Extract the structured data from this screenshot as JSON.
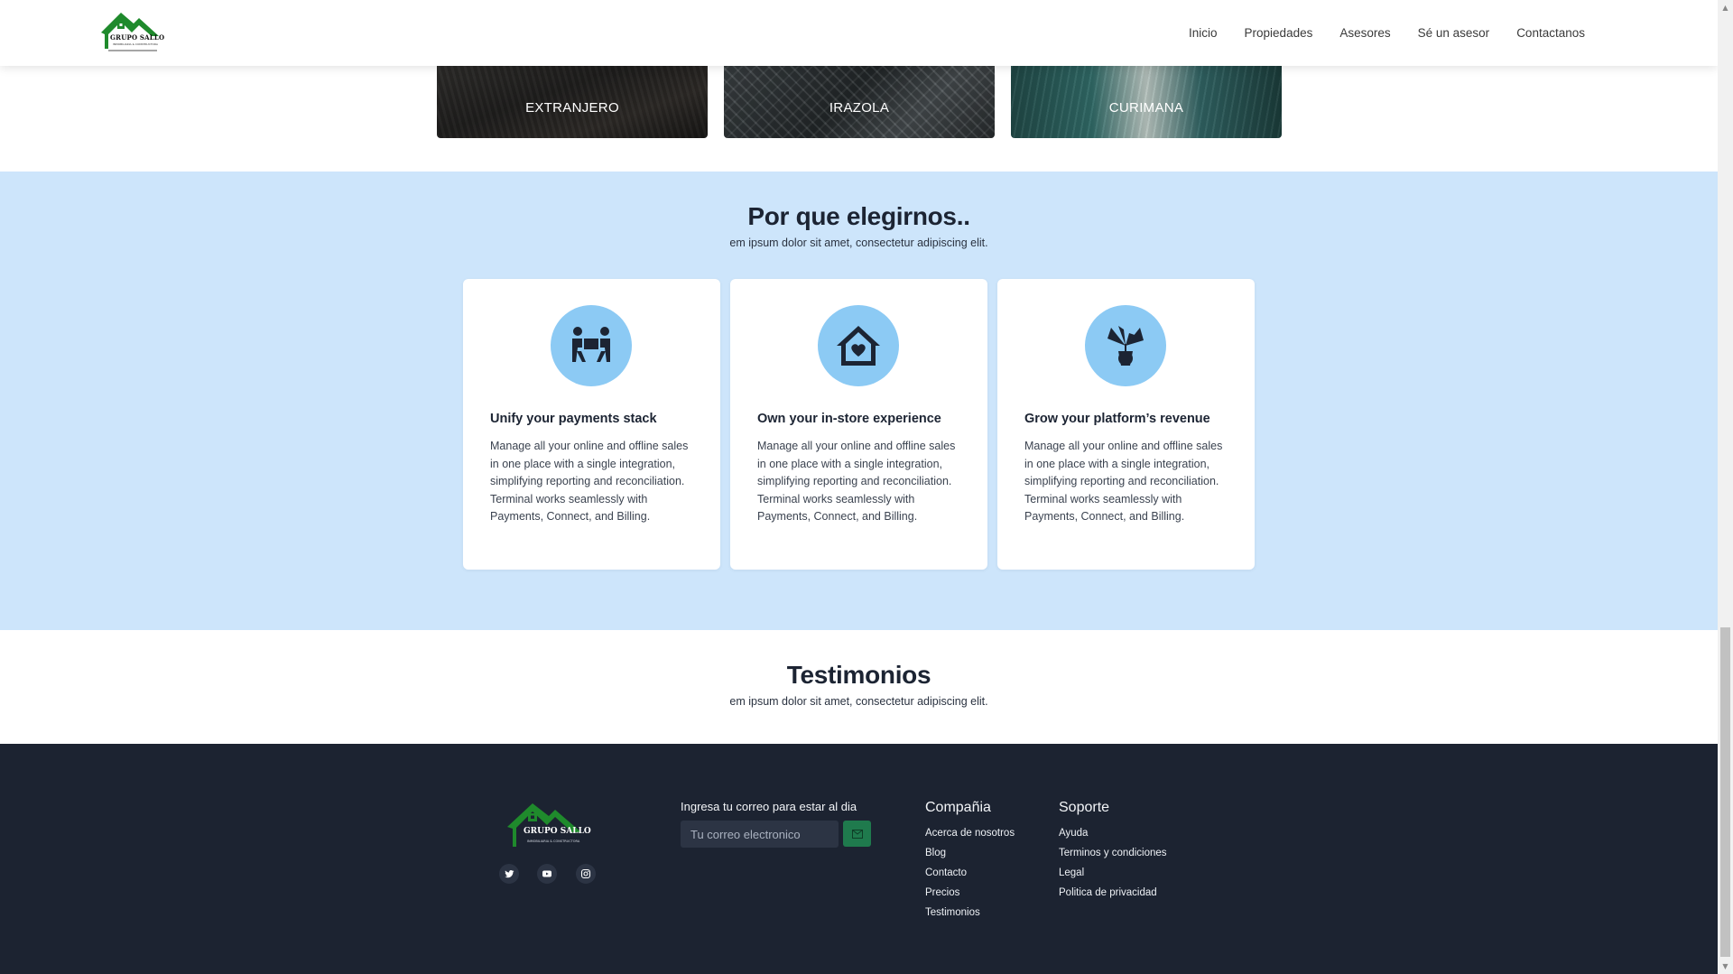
{
  "header": {
    "logo_text": "GRUPO SALLO",
    "logo_subtext": "INMOBILIARIA & CONSTRUCTORA",
    "nav": [
      "Inicio",
      "Propiedades",
      "Asesores",
      "Sé un asesor",
      "Contactanos"
    ]
  },
  "cities": [
    "EXTRANJERO",
    "IRAZOLA",
    "CURIMANA"
  ],
  "why": {
    "title": "Por que elegirnos..",
    "subtitle": "em ipsum dolor sit amet, consectetur adipiscing elit.",
    "cards": [
      {
        "icon": "people-carrying-box-icon",
        "title": "Unify your payments stack",
        "text": "Manage all your online and offline sales in one place with a single integration, simplifying reporting and reconciliation. Terminal works seamlessly with Payments, Connect, and Billing."
      },
      {
        "icon": "house-heart-icon",
        "title": "Own your in-store experience",
        "text": "Manage all your online and offline sales in one place with a single integration, simplifying reporting and reconciliation. Terminal works seamlessly with Payments, Connect, and Billing."
      },
      {
        "icon": "potted-plant-icon",
        "title": "Grow your platform’s revenue",
        "text": "Manage all your online and offline sales in one place with a single integration, simplifying reporting and reconciliation. Terminal works seamlessly with Payments, Connect, and Billing."
      }
    ]
  },
  "testimonials": {
    "title": "Testimonios",
    "subtitle": "em ipsum dolor sit amet, consectetur adipiscing elit."
  },
  "footer": {
    "logo_text": "GRUPO SALLO",
    "logo_subtext": "INMOBILIARIA & CONSTRUCTORA",
    "social": [
      "twitter-icon",
      "youtube-icon",
      "instagram-icon"
    ],
    "newsletter": {
      "label": "Ingresa tu correo para estar al dia",
      "placeholder": "Tu correo electronico"
    },
    "company": {
      "title": "Compañia",
      "links": [
        "Acerca de nosotros",
        "Blog",
        "Contacto",
        "Precios",
        "Testimonios"
      ]
    },
    "support": {
      "title": "Soporte",
      "links": [
        "Ayuda",
        "Terminos y condiciones",
        "Legal",
        "Politica de privacidad"
      ]
    }
  },
  "colors": {
    "section_bg": "#cde5fb",
    "icon_bg": "#8ccaf4",
    "footer_bg": "#1c2331",
    "brand_green": "#1f7a2e",
    "newsletter_button": "#1f7a4d"
  }
}
